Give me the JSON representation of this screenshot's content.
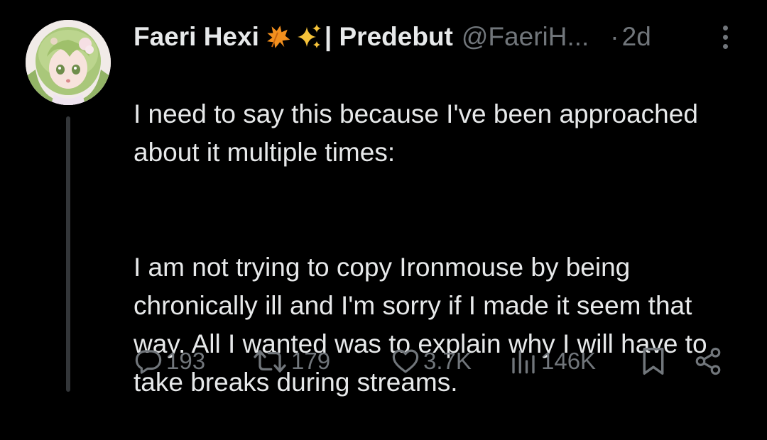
{
  "tweet": {
    "display_name": "Faeri Hexi",
    "name_suffix": "| Predebut",
    "handle": "@FaeriH...",
    "dot": "·",
    "time": "2d",
    "emojis": [
      "maple-leaf-icon",
      "sparkles-icon"
    ],
    "paragraphs": [
      "I need to say this because I've been approached about it multiple times:",
      "I am not trying to copy Ironmouse by being chronically ill and I'm sorry if I made it seem that way. All I wanted was to explain why I will have to take breaks during streams."
    ]
  },
  "actions": {
    "replies": "193",
    "retweets": "179",
    "likes": "3.7K",
    "views": "146K"
  },
  "colors": {
    "background": "#000000",
    "text": "#e7e9ea",
    "secondary": "#71767b",
    "thread_line": "#333639"
  }
}
